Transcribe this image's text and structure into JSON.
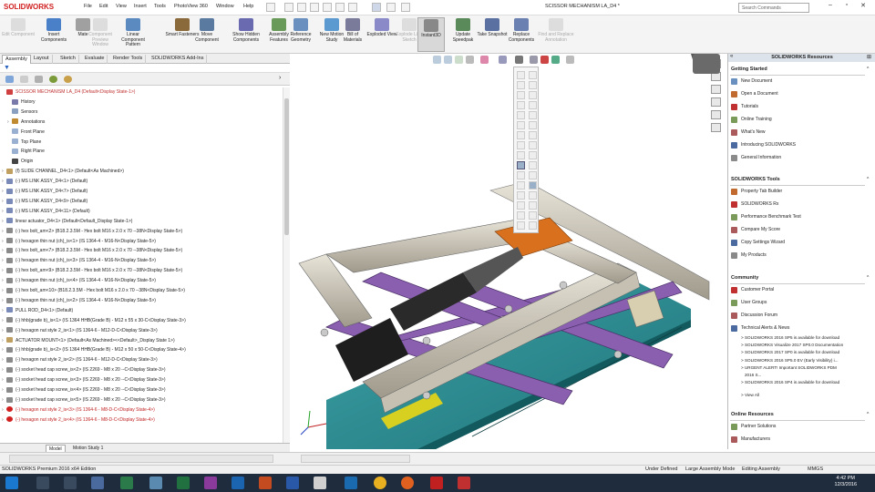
{
  "app": {
    "logo": "SOLIDWORKS",
    "window_title": "SCISSOR MECHANISM LA_D4 *"
  },
  "menu": [
    "File",
    "Edit",
    "View",
    "Insert",
    "Tools",
    "PhotoView 360",
    "Window",
    "Help"
  ],
  "search": {
    "placeholder": "Search Commands"
  },
  "ribbon": [
    {
      "label": "Edit Component",
      "disabled": true
    },
    {
      "label": "Insert Components",
      "disabled": false
    },
    {
      "label": "Mate",
      "disabled": false
    },
    {
      "label": "Component Preview Window",
      "disabled": true
    },
    {
      "label": "Linear Component Pattern",
      "disabled": false
    },
    {
      "label": "Smart Fasteners",
      "disabled": false
    },
    {
      "label": "Move Component",
      "disabled": false
    },
    {
      "label": "Show Hidden Components",
      "disabled": false
    },
    {
      "label": "Assembly Features",
      "disabled": false
    },
    {
      "label": "Reference Geometry",
      "disabled": false
    },
    {
      "label": "New Motion Study",
      "disabled": false
    },
    {
      "label": "Bill of Materials",
      "disabled": false
    },
    {
      "label": "Exploded View",
      "disabled": false
    },
    {
      "label": "Explode Line Sketch",
      "disabled": true
    },
    {
      "label": "Instant3D",
      "disabled": false,
      "active": true
    },
    {
      "label": "Update Speedpak",
      "disabled": false
    },
    {
      "label": "Take Snapshot",
      "disabled": false
    },
    {
      "label": "Replace Components",
      "disabled": false
    },
    {
      "label": "Find and Replace Annotation",
      "disabled": true
    }
  ],
  "command_tabs": [
    "Assembly",
    "Layout",
    "Sketch",
    "Evaluate",
    "Render Tools",
    "SOLIDWORKS Add-Ins"
  ],
  "tree": [
    {
      "text": "SCISSOR MECHANISM LA_D4  (Default<Display State-1>)",
      "kind": "root",
      "icon": "assembly-icon"
    },
    {
      "text": "History",
      "kind": "folder",
      "icon": "history-icon",
      "indent": 1
    },
    {
      "text": "Sensors",
      "kind": "folder",
      "icon": "sensor-icon",
      "indent": 1
    },
    {
      "text": "Annotations",
      "kind": "folder",
      "icon": "annotation-icon",
      "indent": 1,
      "exp": true
    },
    {
      "text": "Front Plane",
      "kind": "plane",
      "icon": "plane-icon",
      "indent": 1
    },
    {
      "text": "Top Plane",
      "kind": "plane",
      "icon": "plane-icon",
      "indent": 1
    },
    {
      "text": "Right Plane",
      "kind": "plane",
      "icon": "plane-icon",
      "indent": 1
    },
    {
      "text": "Origin",
      "kind": "origin",
      "icon": "origin-icon",
      "indent": 1
    },
    {
      "text": "(f) SLIDE CHANNEL_D4<1> (Default<As Machined>)",
      "kind": "part",
      "icon": "part-icon",
      "exp": true
    },
    {
      "text": "(-) MS LINK ASSY_D4<1> (Default)",
      "kind": "asm",
      "icon": "subassembly-icon",
      "exp": true
    },
    {
      "text": "(-) MS LINK ASSY_D4<7> (Default)",
      "kind": "asm",
      "icon": "subassembly-icon",
      "exp": true
    },
    {
      "text": "(-) MS LINK ASSY_D4<9> (Default)",
      "kind": "asm",
      "icon": "subassembly-icon",
      "exp": true
    },
    {
      "text": "(-) MS LINK ASSY_D4<11> (Default)",
      "kind": "asm",
      "icon": "subassembly-icon",
      "exp": true
    },
    {
      "text": "linear actuator_D4<1> (Default<Default_Display State-1>)",
      "kind": "asm",
      "icon": "subassembly-icon",
      "exp": true
    },
    {
      "text": "(-) hex bolt_am<2> (B18.2.3.5M - Hex bolt M16 x 2.0 x 70 --38N<Display State-5>)",
      "kind": "toolbox",
      "icon": "toolbox-icon",
      "exp": true
    },
    {
      "text": "(-) hexagon thin nut (ch)_is<1> (IS 1364-4 - M16-N<Display State-5>)",
      "kind": "toolbox",
      "icon": "toolbox-icon",
      "exp": true
    },
    {
      "text": "(-) hex bolt_am<7> (B18.2.3.5M - Hex bolt M16 x 2.0 x 70 --38N<Display State-5>)",
      "kind": "toolbox",
      "icon": "toolbox-icon",
      "exp": true
    },
    {
      "text": "(-) hexagon thin nut (ch)_is<3> (IS 1364-4 - M16-N<Display State-5>)",
      "kind": "toolbox",
      "icon": "toolbox-icon",
      "exp": true
    },
    {
      "text": "(-) hex bolt_am<9> (B18.2.3.5M - Hex bolt M16 x 2.0 x 70 --38N<Display State-5>)",
      "kind": "toolbox",
      "icon": "toolbox-icon",
      "exp": true
    },
    {
      "text": "(-) hexagon thin nut (ch)_is<4> (IS 1364-4 - M16-N<Display State-5>)",
      "kind": "toolbox",
      "icon": "toolbox-icon",
      "exp": true
    },
    {
      "text": "(-) hex bolt_am<10> (B18.2.3.5M - Hex bolt M16 x 2.0 x 70 --38N<Display State-5>)",
      "kind": "toolbox",
      "icon": "toolbox-icon",
      "exp": true
    },
    {
      "text": "(-) hexagon thin nut (ch)_is<2> (IS 1364-4 - M16-N<Display State-5>)",
      "kind": "toolbox",
      "icon": "toolbox-icon",
      "exp": true
    },
    {
      "text": "PULL ROD_D4<1> (Default)",
      "kind": "asm",
      "icon": "subassembly-icon",
      "exp": true
    },
    {
      "text": "(-) hhb(grade b)_is<1> (IS 1364 HHB(Grade B) - M12 x 55 x 30-C<Display State-3>)",
      "kind": "toolbox",
      "icon": "toolbox-icon",
      "exp": true
    },
    {
      "text": "(-) hexagon nut style 2_is<1> (IS 1364-6 - M12-D-C<Display State-3>)",
      "kind": "toolbox",
      "icon": "toolbox-icon",
      "exp": true
    },
    {
      "text": "ACTUATOR MOUNT<1> (Default<As Machined><<Default>_Display State 1>)",
      "kind": "part",
      "icon": "part-icon",
      "exp": true
    },
    {
      "text": "(-) hhb(grade b)_is<2> (IS 1364 HHB(Grade B) - M12 x 50 x 50-C<Display State-4>)",
      "kind": "toolbox",
      "icon": "toolbox-icon",
      "exp": true
    },
    {
      "text": "(-) hexagon nut style 2_is<2> (IS 1364-6 - M12-D-C<Display State-3>)",
      "kind": "toolbox",
      "icon": "toolbox-icon",
      "exp": true
    },
    {
      "text": "(-) socket head cap screw_is<2> (IS 2269 - M8 x 20 --C<Display State-3>)",
      "kind": "toolbox",
      "icon": "toolbox-icon",
      "exp": true
    },
    {
      "text": "(-) socket head cap screw_is<3> (IS 2269 - M8 x 20 --C<Display State-3>)",
      "kind": "toolbox",
      "icon": "toolbox-icon",
      "exp": true
    },
    {
      "text": "(-) socket head cap screw_is<4> (IS 2269 - M8 x 20 --C<Display State-3>)",
      "kind": "toolbox",
      "icon": "toolbox-icon",
      "exp": true
    },
    {
      "text": "(-) socket head cap screw_is<5> (IS 2269 - M8 x 20 --C<Display State-3>)",
      "kind": "toolbox",
      "icon": "toolbox-icon",
      "exp": true
    },
    {
      "text": "(-) hexagon nut style 2_is<3> (IS 1364-6 - M8-D-C<Display State-4>)",
      "kind": "err",
      "icon": "error-icon",
      "exp": true
    },
    {
      "text": "(-) hexagon nut style 2_is<4> (IS 1364-6 - M8-D-C<Display State-4>)",
      "kind": "err",
      "icon": "error-icon",
      "exp": true
    }
  ],
  "bottom_tabs": [
    "Model",
    "Motion Study 1"
  ],
  "task_pane": {
    "title": "SOLIDWORKS Resources",
    "sections": [
      {
        "title": "Getting Started",
        "items": [
          "New Document",
          "Open a Document",
          "Tutorials",
          "Online Training",
          "What's New",
          "Introducing SOLIDWORKS",
          "General Information"
        ]
      },
      {
        "title": "SOLIDWORKS Tools",
        "items": [
          "Property Tab Builder",
          "SOLIDWORKS Rx",
          "Performance Benchmark Test",
          "Compare My Score",
          "Copy Settings Wizard",
          "My Products"
        ]
      },
      {
        "title": "Community",
        "items": [
          "Customer Portal",
          "User Groups",
          "Discussion Forum",
          "Technical Alerts & News"
        ]
      },
      {
        "title": "Online Resources",
        "items": [
          "Partner Solutions",
          "Manufacturers"
        ]
      }
    ],
    "news": [
      "> SOLIDWORKS 2016 SP5 is available for download",
      "> SOLIDWORKS Visualize 2017 SP0.0 Documentation",
      "> SOLIDWORKS 2017 SP0 is available for download",
      "> SOLIDWORKS 2016 SP5.0 EV (Early Visibility) i...",
      "> URGENT ALERT! Important SOLIDWORKS PDM",
      "2016 S...",
      "> SOLIDWORKS 2016 SP4 is available for download",
      "> View All"
    ]
  },
  "status": {
    "left": "SOLIDWORKS Premium 2016 x64 Edition",
    "defined": "Under Defined",
    "mode": "Large Assembly Mode",
    "editing": "Editing Assembly",
    "units": "MMGS",
    "time": "4:42 PM",
    "date": "12/3/2016"
  }
}
